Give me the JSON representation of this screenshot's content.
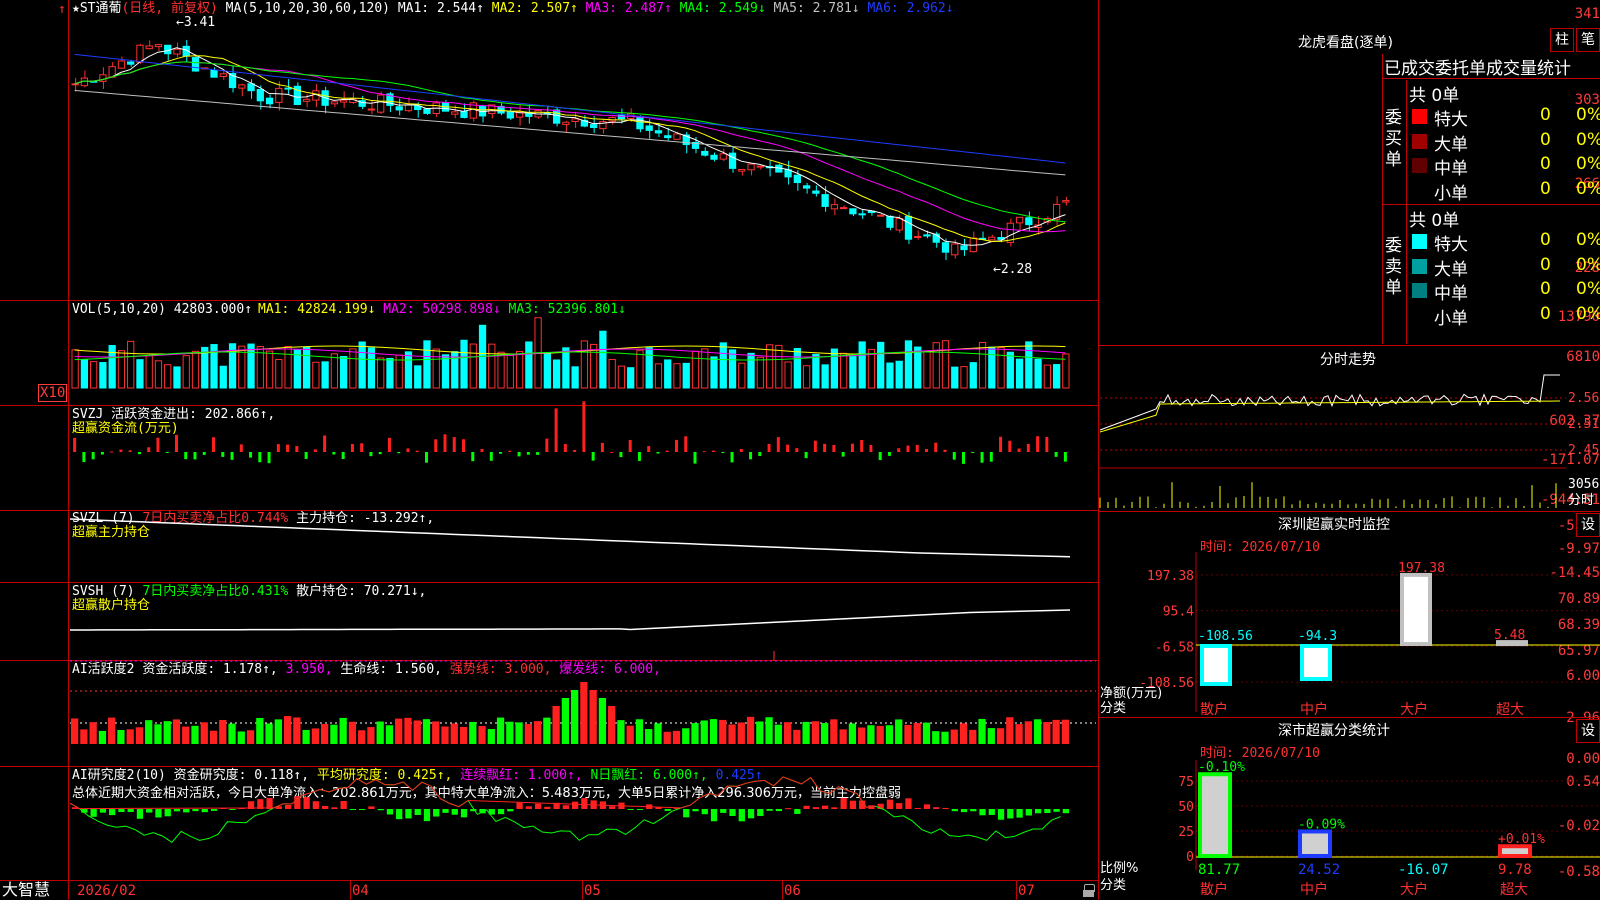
{
  "app": {
    "logo": "大智慧"
  },
  "main_chart": {
    "stock": "★ST通葡",
    "period_label": "(日线, 前复权)",
    "ma_label": "MA(5,10,20,30,60,120)",
    "ma_values": [
      "MA1: 2.544↑",
      "MA2: 2.507↑",
      "MA3: 2.487↑",
      "MA4: 2.549↓",
      "MA5: 2.781↓",
      "MA6: 2.962↓"
    ],
    "y_axis": [
      "341",
      "303",
      "266",
      "228"
    ],
    "high_note": "←3.41",
    "low_note": "←2.28",
    "ma_colors": [
      "#ffffff",
      "#ffff00",
      "#ff00ff",
      "#00ff00",
      "#c0c0c0",
      "#1e3cff"
    ]
  },
  "volume": {
    "label": "VOL(5,10,20)",
    "value": "42803.000↑",
    "ma1": "MA1: 42824.199↓",
    "ma2": "MA2: 50298.898↓",
    "ma3": "MA3: 52396.801↓",
    "y_axis": [
      "13790",
      "6810",
      "X10"
    ]
  },
  "svzj": {
    "label": "SVZJ",
    "value": "活跃资金进出: 202.866↑,",
    "subtitle": "超赢资金流(万元)",
    "y_axis": [
      "602.37",
      "-171.07",
      "-944.51"
    ]
  },
  "svzl": {
    "label": "SVZL (7)",
    "ratio": "7日内买卖净占比0.744%",
    "value": "主力持仓: -13.292↑,",
    "subtitle": "超赢主力持仓",
    "y_axis": [
      "-5.50",
      "-9.97",
      "-14.45"
    ]
  },
  "svsh": {
    "label": "SVSH (7)",
    "ratio": "7日内买卖净占比0.431%",
    "value": "散户持仓: 70.271↓,",
    "subtitle": "超赢散户持仓",
    "y_axis": [
      "70.89",
      "68.39",
      "65.97"
    ]
  },
  "ai_active": {
    "label": "AI活跃度2",
    "value": "资金活跃度: 1.178↑,",
    "v2": "3.950,",
    "life": "生命线: 1.560,",
    "strong": "强势线: 3.000,",
    "burst": "爆发线: 6.000,",
    "y_axis": [
      "6.00",
      "2.96",
      "0.00"
    ]
  },
  "ai_research": {
    "label": "AI研究度2(10)",
    "value": "资金研究度: 0.118↑,",
    "avg": "平均研究度: 0.425↑,",
    "red": "连续飘红: 1.000↑,",
    "nred": "N日飘红: 6.000↑,",
    "last": "0.425↑",
    "summary": "总体近期大资金相对活跃，今日大单净流入：202.861万元，其中特大单净流入：5.483万元，大单5日累计净入296.306万元，当前主力控盘弱",
    "y_axis": [
      "0.54",
      "-0.02",
      "-0.58"
    ]
  },
  "x_axis": [
    "2026/02",
    "04",
    "05",
    "06",
    "07"
  ],
  "dragon": {
    "title": "龙虎看盘(逐单)",
    "btn_col": "柱",
    "btn_row": "笔",
    "tabs": "已成交委托单成交量统计",
    "buy_label": "委买单",
    "sell_label": "委卖单",
    "buy_total": "共 0单",
    "sell_total": "共 0单",
    "buy_rows": [
      {
        "name": "特大",
        "count": "0",
        "pct": "0%",
        "color": "#ff0000"
      },
      {
        "name": "大单",
        "count": "0",
        "pct": "0%",
        "color": "#a00000"
      },
      {
        "name": "中单",
        "count": "0",
        "pct": "0%",
        "color": "#600000"
      },
      {
        "name": "小单",
        "count": "0",
        "pct": "0%",
        "color": ""
      }
    ],
    "sell_rows": [
      {
        "name": "特大",
        "count": "0",
        "pct": "0%",
        "color": "#00ffff"
      },
      {
        "name": "大单",
        "count": "0",
        "pct": "0%",
        "color": "#00a0a0"
      },
      {
        "name": "中单",
        "count": "0",
        "pct": "0%",
        "color": "#008080"
      },
      {
        "name": "小单",
        "count": "0",
        "pct": "0%",
        "color": ""
      }
    ]
  },
  "intraday": {
    "title": "分时走势",
    "y_axis": [
      "2.565",
      "2.510",
      "2.455"
    ],
    "vol_label": "3056",
    "vol_unit": "分时"
  },
  "monitor": {
    "title": "深圳超赢实时监控",
    "setting": "设",
    "time": "时间: 2026/07/10",
    "y_axis": [
      "197.38",
      "95.4",
      "-6.58",
      "-108.56"
    ],
    "unit": "净额(万元)",
    "category": "分类",
    "categories": [
      "散户",
      "中户",
      "大户",
      "超大"
    ],
    "values": [
      -108.56,
      -94.3,
      197.38,
      5.48
    ],
    "value_labels": [
      "-108.56",
      "-94.3",
      "197.38",
      "5.48"
    ]
  },
  "classify": {
    "title": "深市超赢分类统计",
    "setting": "设",
    "time": "时间: 2026/07/10",
    "y_axis": [
      "75",
      "50",
      "25",
      "0"
    ],
    "unit": "比例%",
    "category": "分类",
    "categories": [
      "散户",
      "中户",
      "大户",
      "超大"
    ],
    "top_labels": [
      "-0.10%",
      "-0.09%",
      "",
      "+0.01%"
    ],
    "bottom_labels": [
      "81.77",
      "24.52",
      "-16.07",
      "9.78"
    ],
    "values": [
      81.77,
      24.52,
      -16.07,
      9.78
    ]
  }
}
